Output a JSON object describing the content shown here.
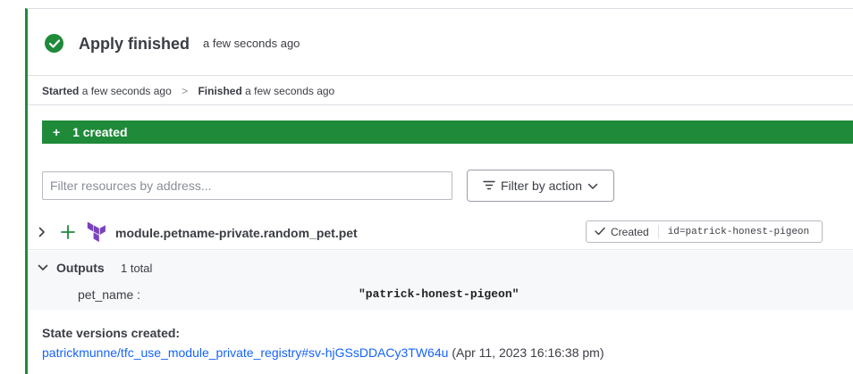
{
  "header": {
    "title": "Apply finished",
    "time": "a few seconds ago"
  },
  "timeline": {
    "started_label": "Started",
    "started_time": "a few seconds ago",
    "separator": ">",
    "finished_label": "Finished",
    "finished_time": "a few seconds ago"
  },
  "summary": {
    "created_label": "1 created"
  },
  "filters": {
    "search_placeholder": "Filter resources by address...",
    "action_button": "Filter by action"
  },
  "resource": {
    "address": "module.petname-private.random_pet.pet",
    "status": "Created",
    "id_text": "id=patrick-honest-pigeon"
  },
  "outputs": {
    "label": "Outputs",
    "total": "1 total",
    "items": [
      {
        "key": "pet_name :",
        "value": "\"patrick-honest-pigeon\""
      }
    ]
  },
  "state": {
    "title": "State versions created:",
    "link": "patrickmunne/tfc_use_module_private_registry#sv-hjGSsDDACy3TW64u",
    "timestamp": "(Apr 11, 2023 16:16:38 pm)"
  },
  "colors": {
    "success": "#1f8a3a",
    "link": "#1563ff",
    "terraform": "#7b42bc"
  }
}
